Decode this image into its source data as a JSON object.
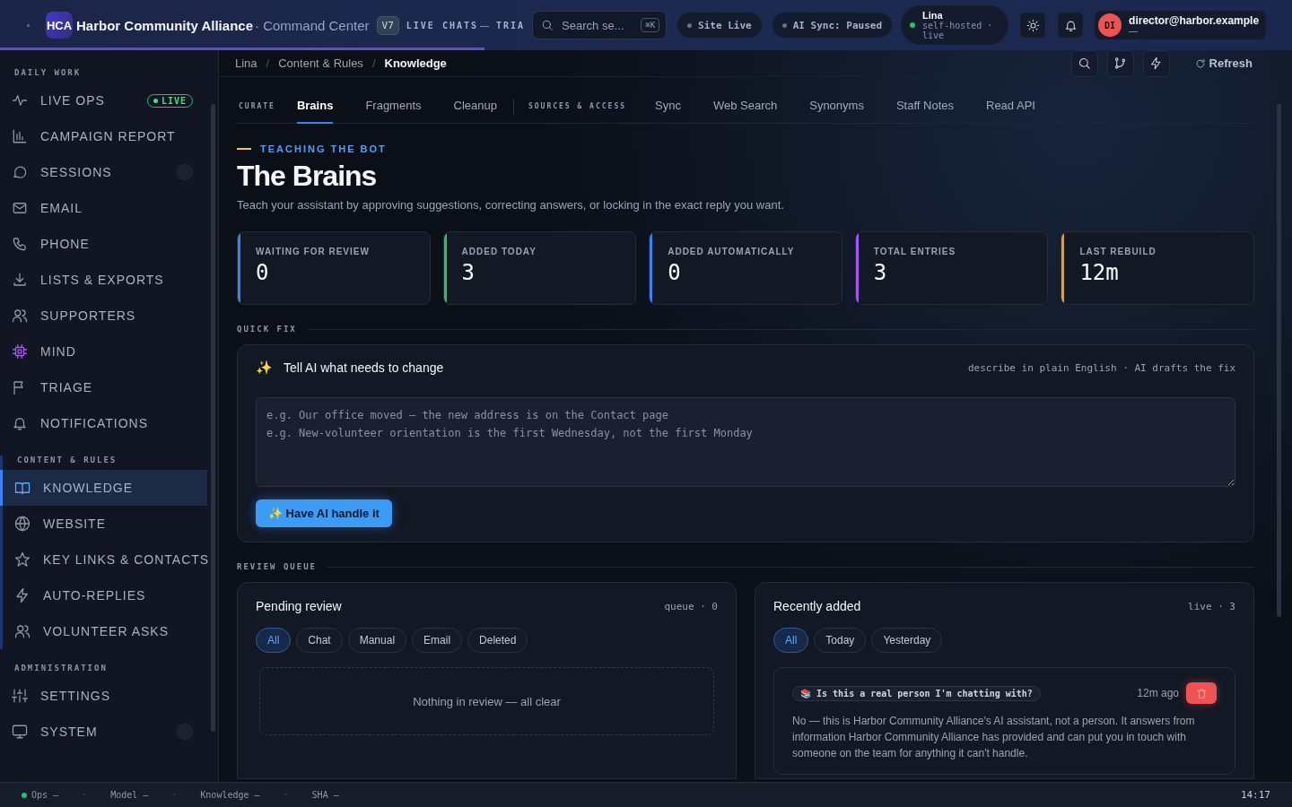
{
  "topbar": {
    "logo": "HCA",
    "title": "Harbor Community Alliance",
    "subtitle": "· Command Center",
    "version": "V7",
    "nav": [
      "LIVE CHATS",
      "TRIA"
    ],
    "live_chats_dash": "—",
    "search": {
      "placeholder": "Search se...",
      "shortcut": "⌘K"
    },
    "pills": [
      {
        "label": "Site Live",
        "color": "#6b7280"
      },
      {
        "label": "AI Sync: Paused",
        "color": "#6b7280"
      }
    ],
    "host": {
      "name": "Lina",
      "detail": "self-hosted · live",
      "color": "#22c55e"
    },
    "user": {
      "initials": "DI",
      "email": "director@harbor.example",
      "role": "—"
    },
    "progress": {
      "level": 0.375
    }
  },
  "sidebar": {
    "sections": [
      {
        "title": "DAILY WORK",
        "items": [
          {
            "label": "LIVE OPS",
            "selected": false,
            "badge": "LIVE"
          },
          {
            "label": "CAMPAIGN REPORT",
            "selected": false
          },
          {
            "label": "SESSIONS",
            "selected": false,
            "dot": true
          },
          {
            "label": "EMAIL",
            "selected": false
          },
          {
            "label": "PHONE",
            "selected": false
          },
          {
            "label": "LISTS & EXPORTS",
            "selected": false
          },
          {
            "label": "SUPPORTERS",
            "selected": false
          },
          {
            "label": "MIND",
            "selected": false
          },
          {
            "label": "TRIAGE",
            "selected": false
          },
          {
            "label": "NOTIFICATIONS",
            "selected": false
          }
        ]
      },
      {
        "title": "CONTENT & RULES",
        "items": [
          {
            "label": "KNOWLEDGE",
            "selected": true
          },
          {
            "label": "WEBSITE",
            "selected": false
          },
          {
            "label": "KEY LINKS & CONTACTS",
            "selected": false
          },
          {
            "label": "AUTO-REPLIES",
            "selected": false
          },
          {
            "label": "VOLUNTEER ASKS",
            "selected": false
          }
        ]
      },
      {
        "title": "ADMINISTRATION",
        "items": [
          {
            "label": "SETTINGS",
            "selected": false
          },
          {
            "label": "SYSTEM",
            "selected": false,
            "dot": true
          }
        ]
      }
    ]
  },
  "breadcrumb": {
    "separator": "/",
    "items": [
      "Lina",
      "Content & Rules",
      "Knowledge"
    ]
  },
  "toolbar": {
    "refresh": "Refresh"
  },
  "tab_groups": [
    {
      "title": "CURATE",
      "tabs": [
        {
          "label": "Brains",
          "selected": true
        },
        {
          "label": "Fragments",
          "selected": false
        },
        {
          "label": "Cleanup",
          "selected": false
        }
      ]
    },
    {
      "title": "SOURCES & ACCESS",
      "tabs": [
        {
          "label": "Sync",
          "selected": false
        },
        {
          "label": "Web Search",
          "selected": false
        },
        {
          "label": "Synonyms",
          "selected": false
        },
        {
          "label": "Staff Notes",
          "selected": false
        },
        {
          "label": "Read API",
          "selected": false
        }
      ]
    }
  ],
  "header": {
    "eyebrow": "TEACHING THE BOT",
    "title": "The Brains",
    "description": "Teach your assistant by approving suggestions, correcting answers, or locking in the exact reply you want."
  },
  "stats": [
    {
      "label": "WAITING FOR REVIEW",
      "value": "0",
      "color": "#3b82f6"
    },
    {
      "label": "ADDED TODAY",
      "value": "3",
      "color": "#22c55e"
    },
    {
      "label": "ADDED AUTOMATICALLY",
      "value": "0",
      "color": "#3b82f6"
    },
    {
      "label": "TOTAL ENTRIES",
      "value": "3",
      "color": "#a855f7"
    },
    {
      "label": "LAST REBUILD",
      "value": "12m",
      "color": "#f59e0b"
    }
  ],
  "quick_fix": {
    "section": "QUICK FIX",
    "icon": "✨",
    "title": "Tell AI what needs to change",
    "hint": "describe in plain English · AI drafts the fix",
    "placeholder": "e.g. Our office moved — the new address is on the Contact page\ne.g. New-volunteer orientation is the first Wednesday, not the first Monday",
    "button": "✨ Have AI handle it"
  },
  "review_queue": {
    "section": "REVIEW QUEUE",
    "pending": {
      "title": "Pending review",
      "meta": "queue · 0",
      "filters": [
        {
          "label": "All",
          "selected": true
        },
        {
          "label": "Chat",
          "selected": false
        },
        {
          "label": "Manual",
          "selected": false
        },
        {
          "label": "Email",
          "selected": false
        },
        {
          "label": "Deleted",
          "selected": false
        }
      ],
      "empty": "Nothing in review — all clear"
    },
    "recent": {
      "title": "Recently added",
      "meta": "live · 3",
      "filters": [
        {
          "label": "All",
          "selected": true
        },
        {
          "label": "Today",
          "selected": false
        },
        {
          "label": "Yesterday",
          "selected": false
        }
      ],
      "entries": [
        {
          "icon": "📚",
          "question": "Is this a real person I'm chatting with?",
          "time": "12m ago",
          "answer": "No — this is Harbor Community Alliance's AI assistant, not a person. It answers from information Harbor Community Alliance has provided and can put you in touch with someone on the team for anything it can't handle."
        }
      ]
    }
  },
  "status_bar": {
    "separator": "·",
    "items": [
      {
        "label": "Ops —",
        "color": "#22c55e"
      },
      {
        "label": "Model —"
      },
      {
        "label": "Knowledge —"
      },
      {
        "label": "SHA —"
      }
    ],
    "time": "14:17"
  }
}
